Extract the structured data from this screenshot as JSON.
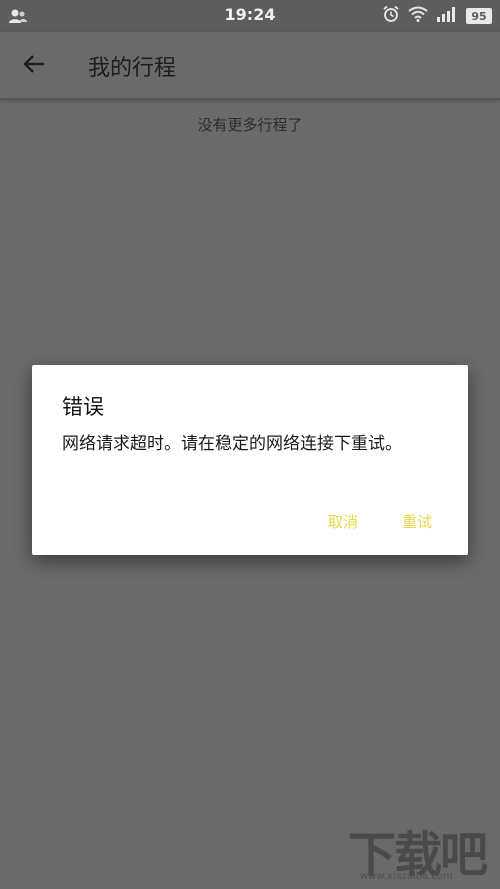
{
  "status_bar": {
    "time": "19:24",
    "battery": "95",
    "icons": [
      "contacts-icon",
      "alarm-icon",
      "wifi-icon",
      "signal-icon"
    ]
  },
  "app_bar": {
    "back_icon": "back-arrow-icon",
    "title": "我的行程"
  },
  "content": {
    "empty_text": "没有更多行程了"
  },
  "dialog": {
    "title": "错误",
    "message": "网络请求超时。请在稳定的网络连接下重试。",
    "cancel_label": "取消",
    "retry_label": "重试"
  },
  "watermark": {
    "logo": "下载吧",
    "url": "www.xiazaiba.com"
  },
  "colors": {
    "overlay_bg": "#6a6a6a",
    "dialog_bg": "#ffffff",
    "accent": "#ecd648"
  }
}
